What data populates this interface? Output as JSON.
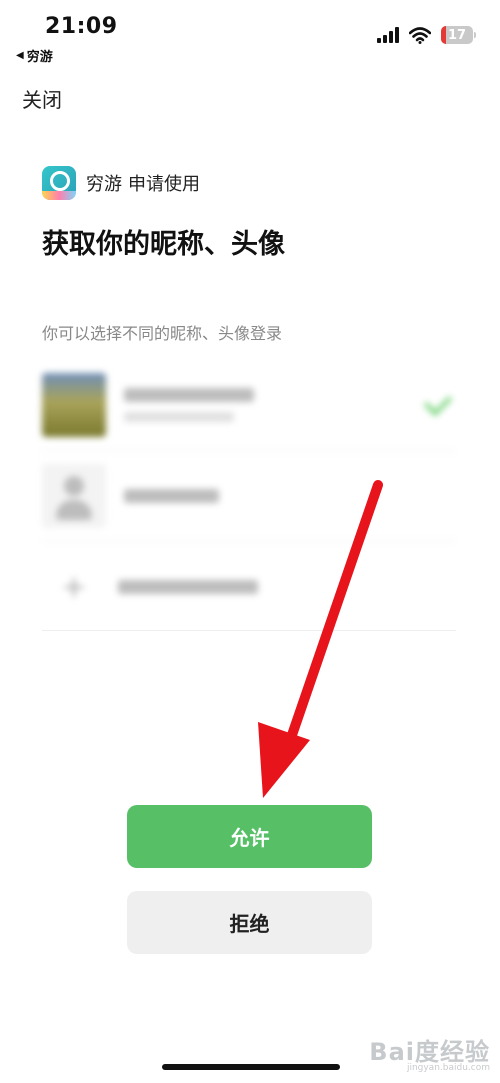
{
  "status_bar": {
    "time": "21:09",
    "back_app": "穷游",
    "battery": "17"
  },
  "nav": {
    "close_label": "关闭"
  },
  "request": {
    "app_name": "穷游",
    "request_text": "申请使用",
    "title": "获取你的昵称、头像",
    "hint": "你可以选择不同的昵称、头像登录"
  },
  "options": [
    {
      "kind": "photo-avatar",
      "selected": true,
      "blurred": true
    },
    {
      "kind": "default-avatar",
      "selected": false,
      "blurred": true
    },
    {
      "kind": "add-new",
      "icon": "plus-icon",
      "selected": false,
      "blurred": true
    }
  ],
  "buttons": {
    "allow_label": "允许",
    "deny_label": "拒绝"
  },
  "annotation": {
    "icon": "red-arrow-icon",
    "color": "#e8141b"
  },
  "watermark": {
    "brand": "Bai度经验",
    "url": "jingyan.baidu.com"
  },
  "colors": {
    "allow_bg": "#57c067",
    "deny_bg": "#efefef",
    "hint": "#888888"
  }
}
